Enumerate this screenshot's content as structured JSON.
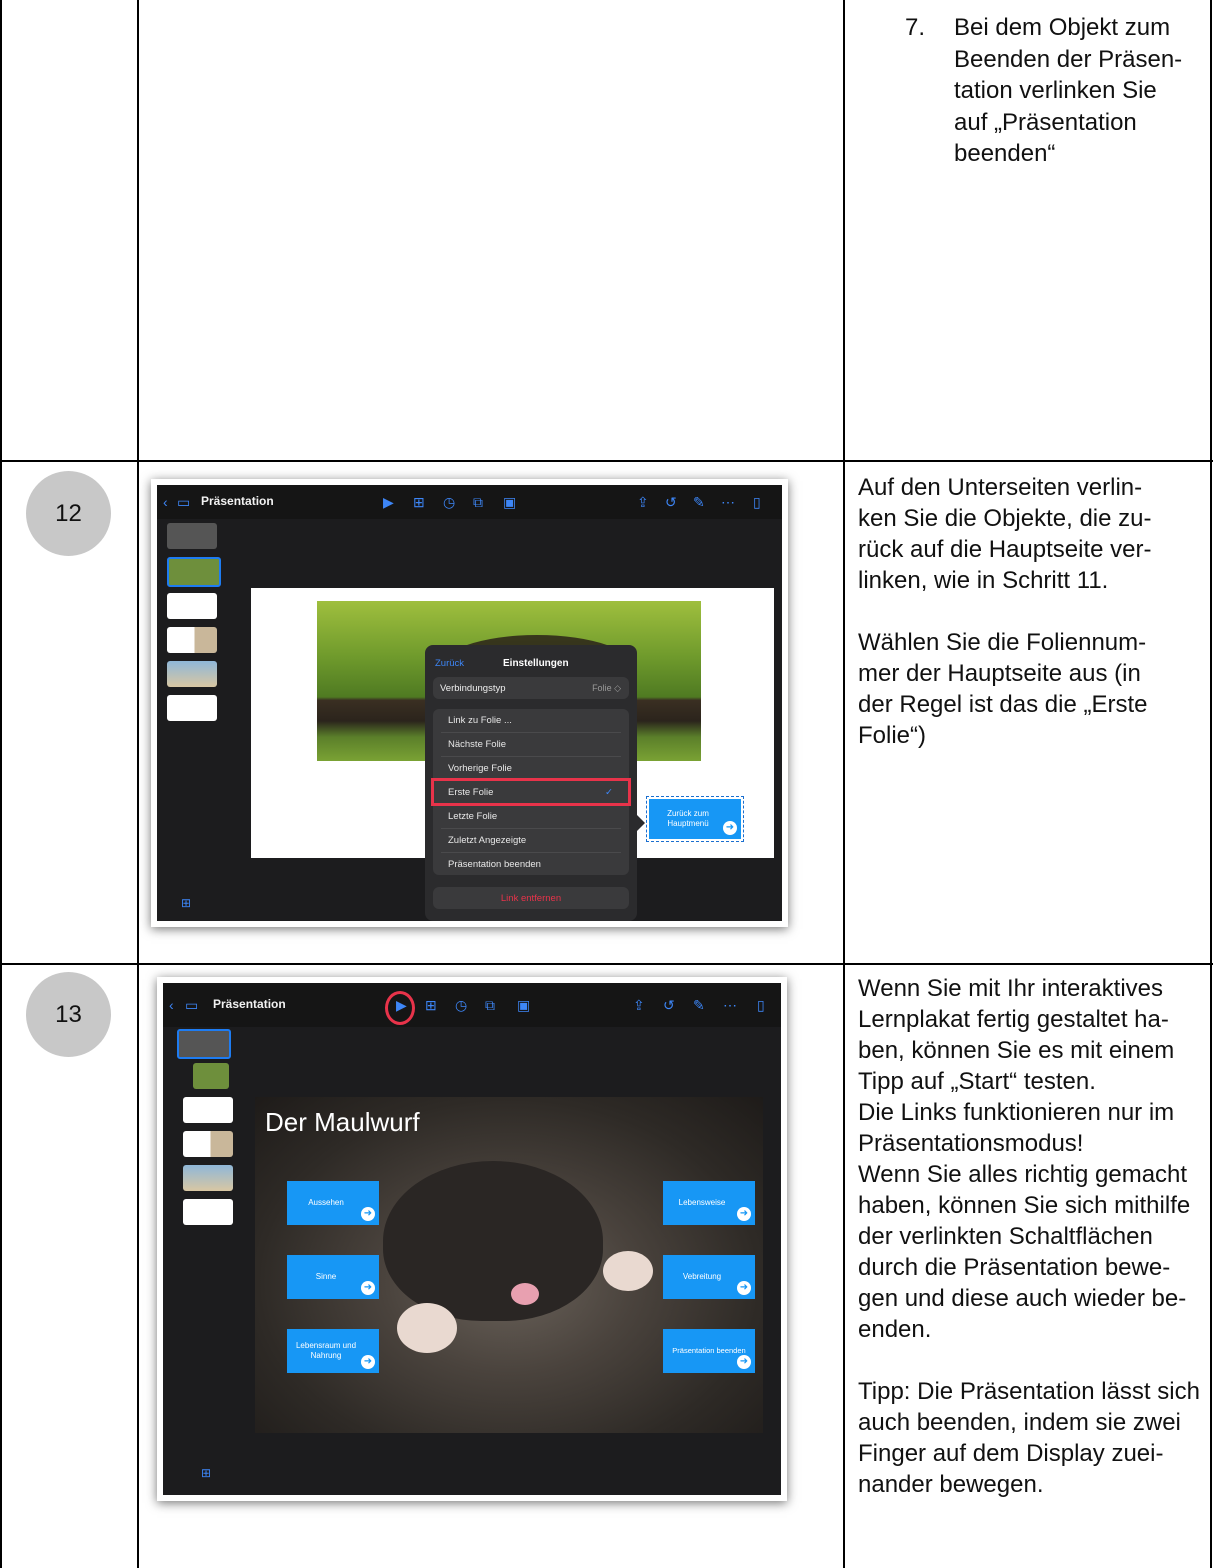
{
  "step7": {
    "number": "7.",
    "text": "Bei dem Objekt zum\nBeenden der Präsen-\ntation verlinken Sie\nauf „Präsentation\nbeenden“"
  },
  "rows": [
    {
      "number": "12",
      "description": "Auf den Unterseiten verlin-\nken Sie die Objekte, die zu-\nrück auf die Hauptseite ver-\nlinken, wie in Schritt 11.\n\nWählen Sie die Foliennum-\nmer der Hauptseite aus (in\nder Regel ist das die „Erste\nFolie“)"
    },
    {
      "number": "13",
      "description": "Wenn Sie mit Ihr interaktives\nLernplakat fertig gestaltet ha-\nben, können Sie es mit einem\nTipp auf „Start“ testen.\nDie Links funktionieren nur im\nPräsentationsmodus!\nWenn Sie alles richtig gemacht\nhaben, können Sie sich mithilfe\nder verlinkten Schaltflächen\ndurch die Präsentation bewe-\ngen und diese auch wieder be-\nenden.\n\nTipp: Die Präsentation lässt sich\nauch beenden, indem sie zwei\nFinger auf dem Display zuei-\nnander bewegen."
    }
  ],
  "screenshot12": {
    "toolbar_title": "Präsentation",
    "popover": {
      "back": "Zurück",
      "title": "Einstellungen",
      "connection_label": "Verbindungstyp",
      "connection_value": "Folie ◇",
      "items": [
        "Link zu Folie ...",
        "Nächste Folie",
        "Vorherige Folie",
        "Erste Folie",
        "Letzte Folie",
        "Zuletzt Angezeigte",
        "Präsentation beenden"
      ],
      "remove": "Link entfernen"
    },
    "button": "Zurück zum\nHauptmenü",
    "colors": {
      "highlight": "#e8334a",
      "blue": "#1797f5"
    }
  },
  "screenshot13": {
    "toolbar_title": "Präsentation",
    "slide_title": "Der Maulwurf",
    "buttons_left": [
      "Aussehen",
      "Sinne",
      "Lebensraum und\nNahrung"
    ],
    "buttons_right": [
      "Lebensweise",
      "Vebreitung",
      "Präsentation beenden"
    ]
  }
}
